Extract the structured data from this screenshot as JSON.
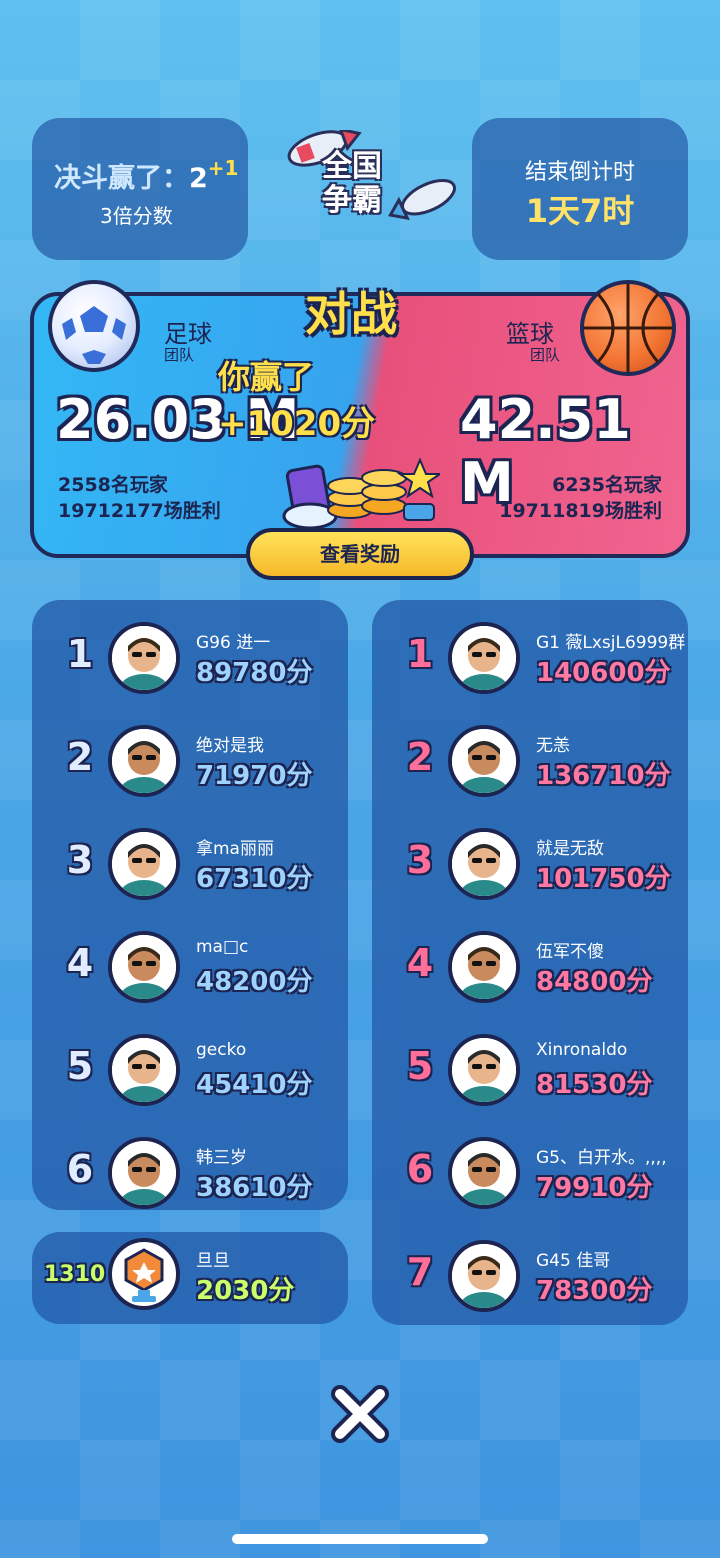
{
  "header": {
    "duel_won_label": "决斗赢了：",
    "duel_won_value": "2",
    "duel_won_bonus": "+1",
    "multiplier": "3倍分数",
    "event_title_line1": "全国",
    "event_title_line2": "争霸",
    "countdown_label": "结束倒计时",
    "countdown_value": "1天7时"
  },
  "battle": {
    "title": "对战",
    "result_text": "你赢了",
    "gain_text": "+1020分",
    "left_team": {
      "name": "足球",
      "sub": "团队",
      "score": "26.03 M",
      "players": "2558名玩家",
      "wins": "19712177场胜利"
    },
    "right_team": {
      "name": "篮球",
      "sub": "团队",
      "score": "42.51 M",
      "players": "6235名玩家",
      "wins": "19711819场胜利"
    },
    "reward_button": "查看奖励"
  },
  "left_list": [
    {
      "rank": "1",
      "name": "G96 进一",
      "score": "89780分"
    },
    {
      "rank": "2",
      "name": "绝对是我",
      "score": "71970分"
    },
    {
      "rank": "3",
      "name": "拿ma丽丽",
      "score": "67310分"
    },
    {
      "rank": "4",
      "name": "ma□c",
      "score": "48200分"
    },
    {
      "rank": "5",
      "name": "gecko",
      "score": "45410分"
    },
    {
      "rank": "6",
      "name": "韩三岁",
      "score": "38610分"
    }
  ],
  "self_row": {
    "rank": "1310",
    "name": "旦旦",
    "score": "2030分"
  },
  "right_list": [
    {
      "rank": "1",
      "name": "G1 薇LxsjL6999群",
      "score": "140600分"
    },
    {
      "rank": "2",
      "name": "无恙",
      "score": "136710分"
    },
    {
      "rank": "3",
      "name": "就是无敌",
      "score": "101750分"
    },
    {
      "rank": "4",
      "name": "伍军不傻",
      "score": "84800分"
    },
    {
      "rank": "5",
      "name": "Xinronaldo",
      "score": "81530分"
    },
    {
      "rank": "6",
      "name": "G5、白开水。,,,,",
      "score": "79910分"
    },
    {
      "rank": "7",
      "name": "G45 佳哥",
      "score": "78300分"
    }
  ],
  "colors": {
    "left_accent": "#9fd3ff",
    "right_accent": "#ff79a2",
    "self_accent": "#c9ff6a",
    "gold": "#ffe04a"
  }
}
